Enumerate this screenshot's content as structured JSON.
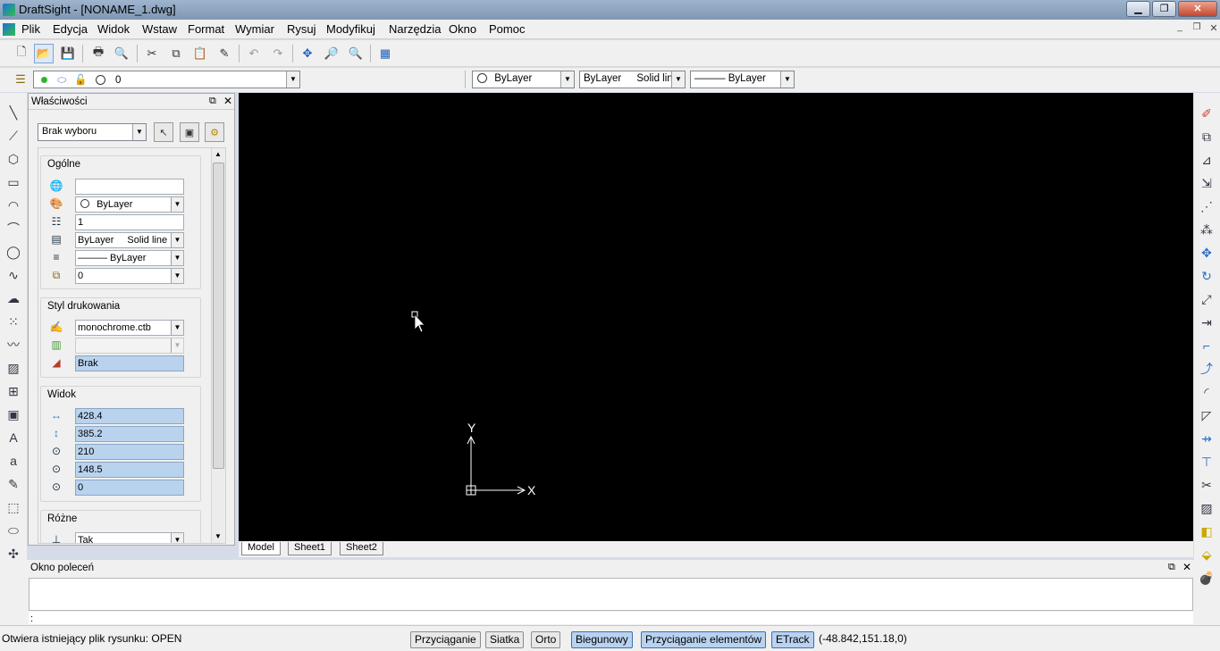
{
  "window": {
    "title": "DraftSight - [NONAME_1.dwg]",
    "close": "✕",
    "minimize": "▁",
    "maximize": "❐"
  },
  "menu": [
    "Plik",
    "Edycja",
    "Widok",
    "Wstaw",
    "Format",
    "Wymiar",
    "Rysuj",
    "Modyfikuj",
    "Narzędzia",
    "Okno",
    "Pomoc"
  ],
  "layer_toolbar": {
    "layer_value": "0"
  },
  "props_toolbar": {
    "color": "ByLayer",
    "linestyle_name": "ByLayer",
    "linestyle_type": "Solid line",
    "lineweight": "——— ByLayer"
  },
  "properties": {
    "title": "Właściwości",
    "selection": "Brak wyboru",
    "general": {
      "title": "Ogólne",
      "color": "ByLayer",
      "scale": "1",
      "linestyle_name": "ByLayer",
      "linestyle_type": "Solid line",
      "lineweight": "——— ByLayer",
      "layer": "0"
    },
    "print": {
      "title": "Styl drukowania",
      "table": "monochrome.ctb",
      "style": "",
      "value": "Brak"
    },
    "view": {
      "title": "Widok",
      "width": "428.4",
      "height": "385.2",
      "cx": "210",
      "cy": "148.5",
      "cz": "0"
    },
    "misc": {
      "title": "Różne",
      "value": "Tak"
    }
  },
  "canvas": {
    "x_label": "X",
    "y_label": "Y"
  },
  "tabs": [
    "Model",
    "Sheet1",
    "Sheet2"
  ],
  "command": {
    "title": "Okno poleceń",
    "prompt": ":"
  },
  "status": {
    "message": "Otwiera istniejący plik rysunku:  OPEN",
    "buttons": [
      {
        "label": "Przyciąganie",
        "on": false
      },
      {
        "label": "Siatka",
        "on": false
      },
      {
        "label": "Orto",
        "on": false
      },
      {
        "label": "Biegunowy",
        "on": true
      },
      {
        "label": "Przyciąganie elementów",
        "on": true
      },
      {
        "label": "ETrack",
        "on": true
      }
    ],
    "coords": "(-48.842,151.18,0)"
  }
}
